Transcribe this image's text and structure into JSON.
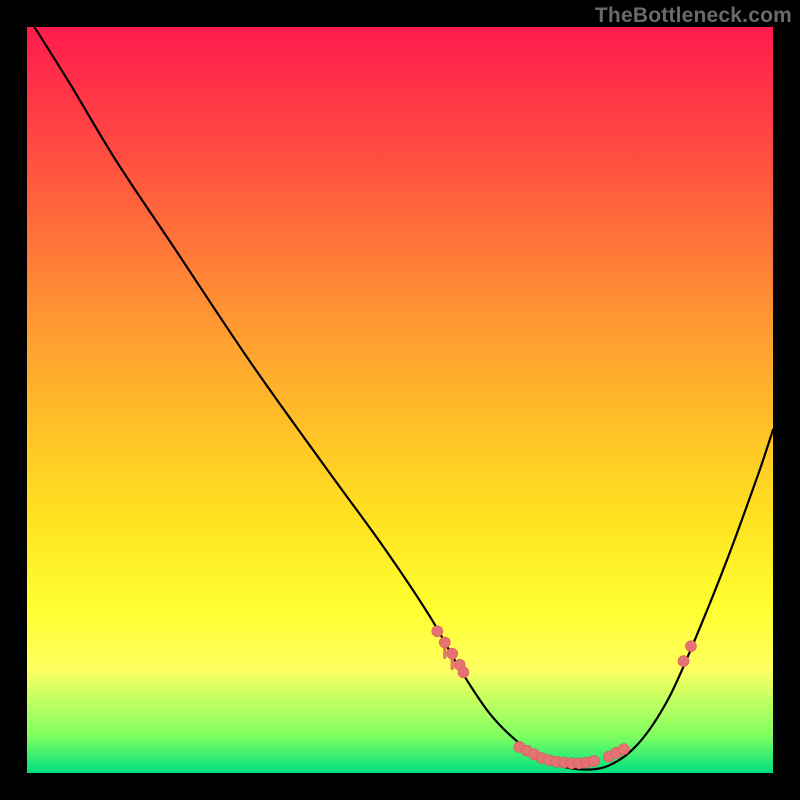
{
  "watermark": "TheBottleneck.com",
  "colors": {
    "dot": "#e57373",
    "curve": "#000000"
  },
  "chart_data": {
    "type": "line",
    "title": "",
    "xlabel": "",
    "ylabel": "",
    "xlim": [
      0,
      100
    ],
    "ylim": [
      0,
      100
    ],
    "note": "No axis ticks or numeric labels are rendered in the image; values are normalized 0–100 estimates read from position within the plot frame.",
    "series": [
      {
        "name": "bottleneck-curve",
        "x": [
          1,
          6,
          12,
          20,
          30,
          40,
          48,
          54,
          58,
          62,
          66,
          70,
          74,
          78,
          82,
          86,
          90,
          94,
          98,
          100
        ],
        "y": [
          100,
          92,
          82,
          70,
          55,
          41,
          30,
          21,
          14,
          8,
          4,
          1.5,
          0.5,
          1,
          4,
          10,
          19,
          29,
          40,
          46
        ]
      }
    ],
    "highlight_points": {
      "name": "marked-points",
      "x": [
        55,
        56,
        57,
        58,
        58.5,
        66,
        67,
        68,
        69,
        70,
        71,
        72,
        73,
        74,
        75,
        76,
        78,
        79,
        80,
        88,
        89
      ],
      "y": [
        19,
        17.5,
        16,
        14.5,
        13.5,
        3.5,
        3,
        2.5,
        2,
        1.7,
        1.5,
        1.4,
        1.3,
        1.3,
        1.4,
        1.6,
        2.2,
        2.7,
        3.2,
        15,
        17
      ]
    },
    "drips": [
      {
        "x": 56,
        "y_top": 17.5,
        "y_bottom": 15.5
      },
      {
        "x": 57,
        "y_top": 16,
        "y_bottom": 14
      }
    ]
  }
}
